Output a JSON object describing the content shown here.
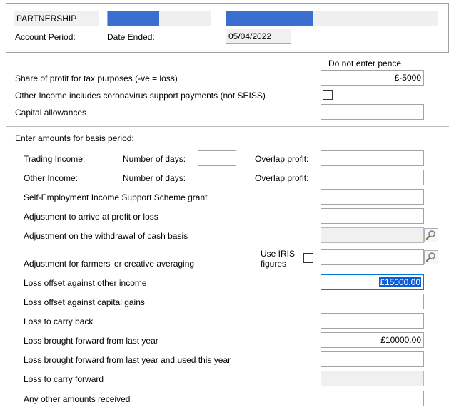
{
  "header": {
    "entity_type": "PARTNERSHIP",
    "account_period_label": "Account Period:",
    "date_ended_label": "Date Ended:",
    "date_ended_value": "05/04/2022",
    "progress_small": 0.5,
    "progress_large": 0.41
  },
  "profit": {
    "pence_note": "Do not enter pence",
    "share_label": "Share of profit for tax purposes (-ve = loss)",
    "share_value": "£-5000",
    "coronavirus_label": "Other Income includes coronavirus support payments (not SEISS)",
    "coronavirus_checked": false,
    "capital_allowances_label": "Capital allowances",
    "capital_allowances_value": ""
  },
  "basis": {
    "section_label": "Enter amounts for basis period:",
    "trading_income_label": "Trading Income:",
    "other_income_label": "Other Income:",
    "number_of_days_label": "Number of days:",
    "overlap_profit_label": "Overlap profit:",
    "seiss_label": "Self-Employment Income Support Scheme grant",
    "adjustment_profit_label": "Adjustment to arrive at profit or loss",
    "adjustment_cash_label": "Adjustment on the withdrawal of cash basis",
    "adjustment_farmers_label": "Adjustment for farmers' or creative averaging",
    "use_iris_label_line1": "Use IRIS",
    "use_iris_label_line2": "figures",
    "loss_other_income_label": "Loss offset against other income",
    "loss_other_income_value": "£15000.00",
    "loss_capital_gains_label": "Loss offset against capital gains",
    "loss_carry_back_label": "Loss to carry back",
    "loss_bf_label": "Loss brought forward from last year",
    "loss_bf_value": "£10000.00",
    "loss_bf_used_label": "Loss brought forward from last year and used this year",
    "loss_cf_label": "Loss to carry forward",
    "other_amounts_label": "Any other amounts received"
  },
  "colors": {
    "progress_fill": "#3a6fd0",
    "selection": "#0b5cd7",
    "focus_border": "#0078d7"
  }
}
